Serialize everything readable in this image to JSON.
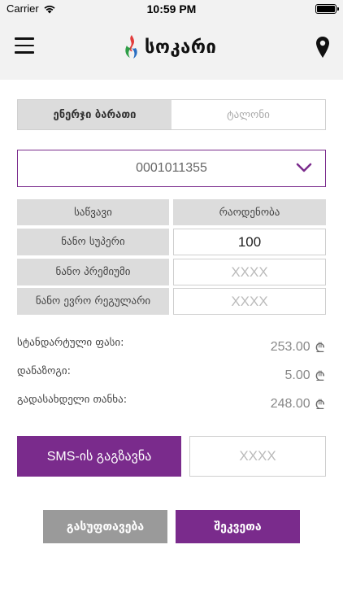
{
  "status_bar": {
    "carrier": "Carrier",
    "time": "10:59 PM"
  },
  "header": {
    "logo_text": "სოკარი",
    "menu_icon": "hamburger-menu-icon",
    "location_icon": "map-pin-icon"
  },
  "tabs": [
    {
      "label": "ენერჯი ბარათი",
      "active": true
    },
    {
      "label": "ტალონი",
      "active": false
    }
  ],
  "card_select": {
    "value": "0001011355",
    "icon": "chevron-down-icon"
  },
  "fuel_table": {
    "headers": [
      "საწვავი",
      "რაოდენობა"
    ],
    "rows": [
      {
        "fuel": "ნანო სუპერი",
        "quantity": "100",
        "filled": true
      },
      {
        "fuel": "ნანო პრემიუმი",
        "quantity": "XXXX",
        "filled": false
      },
      {
        "fuel": "ნანო ევრო რეგულარი",
        "quantity": "XXXX",
        "filled": false
      }
    ]
  },
  "summary": [
    {
      "label": "სტანდარტული ფასი:",
      "value": "253.00",
      "currency": "₾"
    },
    {
      "label": "დანაზოგი:",
      "value": "5.00",
      "currency": "₾"
    },
    {
      "label": "გადასახდელი თანხა:",
      "value": "248.00",
      "currency": "₾"
    }
  ],
  "sms": {
    "button_label": "SMS-ის გაგზავნა",
    "code_placeholder": "XXXX"
  },
  "actions": {
    "clear_label": "გასუფთავება",
    "order_label": "შეკვეთა"
  },
  "colors": {
    "accent": "#7a2b8c",
    "header_bg": "#f2f2f2",
    "label_bg": "#dcdcdc",
    "clear_button": "#9a9a9a"
  }
}
